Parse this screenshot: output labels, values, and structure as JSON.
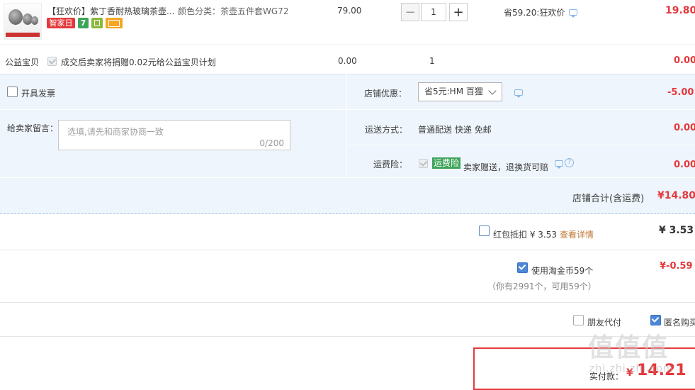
{
  "item": {
    "tag": "【狂欢价】",
    "title": "紫丁香耐热玻璃茶壶...",
    "spec_label": "颜色分类：",
    "spec_value": "茶壶五件套WG72",
    "badge_day": "智家日",
    "badge_seven": "7",
    "price": "79.00",
    "quantity": "1",
    "discount_note": "省59.20:狂欢价",
    "subtotal": "19.80"
  },
  "charity": {
    "label": "公益宝贝",
    "desc": "成交后卖家将捐赠0.02元给公益宝贝计划",
    "price": "0.00",
    "quantity": "1",
    "subtotal": "0.00"
  },
  "invoice": {
    "label": "开具发票"
  },
  "message": {
    "label": "给卖家留言：",
    "placeholder": "选填,请先和商家协商一致",
    "counter": "0/200"
  },
  "shop_discount": {
    "label": "店铺优惠：",
    "selected": "省5元:HM 百狸",
    "amount": "-5.00"
  },
  "shipping": {
    "label": "运送方式：",
    "value": "普通配送 快递 免邮",
    "amount": "0.00"
  },
  "insurance": {
    "label": "运费险：",
    "badge": "运费险",
    "text": "卖家赠送，退换货可赔",
    "amount": "0.00"
  },
  "shop_total": {
    "label": "店铺合计(含运费)",
    "amount": "¥14.80"
  },
  "red_packet": {
    "label": "红包抵扣 ¥ 3.53",
    "link": "查看详情",
    "amount": "¥ 3.53"
  },
  "taojinbi": {
    "label": "使用淘金币59个",
    "sub": "（你有2991个，可用59个）",
    "amount": "¥-0.59"
  },
  "options": {
    "friend_pay": "朋友代付",
    "anonymous": "匿名购买"
  },
  "payment": {
    "label": "实付款：",
    "currency": "¥",
    "amount": "14.21"
  },
  "watermark": {
    "big": "值值值",
    "url": "zhi.zhi.zhi.com"
  },
  "colors": {
    "accent_red": "#e4393c",
    "blue_bg": "#eef5fc",
    "check_blue": "#4d87d7",
    "green_badge": "#3ea45a"
  }
}
